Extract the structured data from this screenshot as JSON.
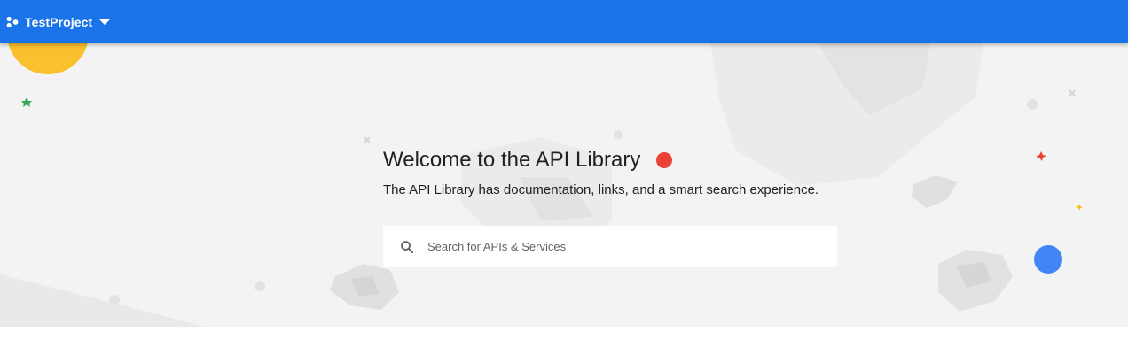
{
  "header": {
    "project_name": "TestProject",
    "project_icon": "project-hierarchy-icon",
    "dropdown_icon": "caret-down-icon",
    "color": "#1a73e8"
  },
  "hero": {
    "title": "Welcome to the API Library",
    "subtitle": "The API Library has documentation, links, and a smart search experience.",
    "background_color": "#f3f3f3"
  },
  "search": {
    "placeholder": "Search for APIs & Services",
    "value": "",
    "icon": "search-icon"
  },
  "colors": {
    "yellow": "#fbbc04",
    "red": "#ea4335",
    "blue": "#4285f4",
    "green": "#34a853"
  }
}
